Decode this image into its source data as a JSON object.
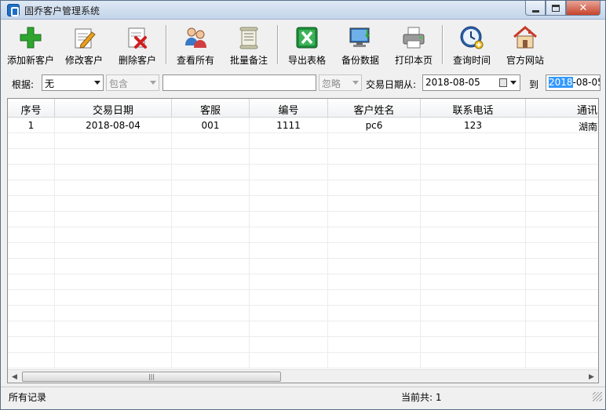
{
  "window": {
    "title": "固乔客户管理系统",
    "buttons": {
      "minimize": "minimize-icon",
      "maximize": "maximize-icon",
      "close": "✕"
    }
  },
  "toolbar": {
    "items": [
      {
        "label": "添加新客户",
        "icon": "add-plus-icon",
        "color": "#2fa52f"
      },
      {
        "label": "修改客户",
        "icon": "edit-pencil-icon",
        "color": "#e8a020"
      },
      {
        "label": "删除客户",
        "icon": "delete-x-icon",
        "color": "#d02020"
      },
      {
        "label": "查看所有",
        "icon": "users-group-icon",
        "color": "#3a78c8"
      },
      {
        "label": "批量备注",
        "icon": "scroll-note-icon",
        "color": "#b8b8a0"
      },
      {
        "label": "导出表格",
        "icon": "excel-icon",
        "color": "#1e8c3a"
      },
      {
        "label": "备份数据",
        "icon": "computer-backup-icon",
        "color": "#2a6fb8"
      },
      {
        "label": "打印本页",
        "icon": "printer-icon",
        "color": "#7a7a7a"
      },
      {
        "label": "查询时间",
        "icon": "clock-icon",
        "color": "#2c5fa8"
      },
      {
        "label": "官方网站",
        "icon": "home-icon",
        "color": "#c83a2a"
      }
    ]
  },
  "filter": {
    "basis_label": "根据:",
    "basis_value": "无",
    "match_value": "包含",
    "keyword_value": "",
    "ignore_value": "忽略",
    "date_from_label": "交易日期从:",
    "date_from_value": "2018-08-05",
    "date_to_label": "到",
    "date_to_selected": "2018",
    "date_to_rest": "-08-05"
  },
  "grid": {
    "columns": [
      "序号",
      "交易日期",
      "客服",
      "编号",
      "客户姓名",
      "联系电话",
      "通讯"
    ],
    "rows": [
      [
        "1",
        "2018-08-04",
        "001",
        "1111",
        "pc6",
        "123",
        "湖南"
      ]
    ]
  },
  "status": {
    "left": "所有记录",
    "right": "当前共: 1"
  }
}
